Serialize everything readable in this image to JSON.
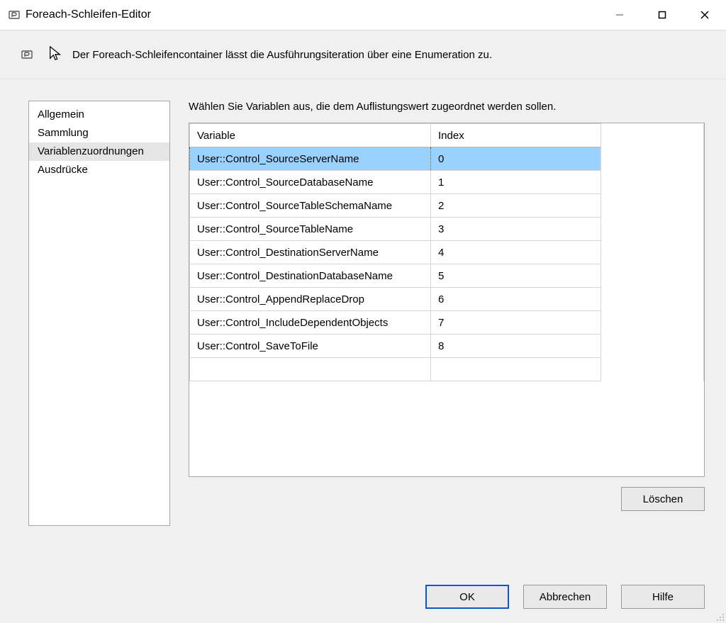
{
  "window": {
    "title": "Foreach-Schleifen-Editor"
  },
  "description": "Der Foreach-Schleifencontainer lässt die Ausführungsiteration über eine Enumeration zu.",
  "sidebar": {
    "items": [
      {
        "label": "Allgemein",
        "selected": false
      },
      {
        "label": "Sammlung",
        "selected": false
      },
      {
        "label": "Variablenzuordnungen",
        "selected": true
      },
      {
        "label": "Ausdrücke",
        "selected": false
      }
    ]
  },
  "content": {
    "instruction": "Wählen Sie Variablen aus, die dem Auflistungswert zugeordnet werden sollen.",
    "columns": {
      "variable": "Variable",
      "index": "Index"
    },
    "rows": [
      {
        "variable": "User::Control_SourceServerName",
        "index": "0",
        "selected": true
      },
      {
        "variable": "User::Control_SourceDatabaseName",
        "index": "1",
        "selected": false
      },
      {
        "variable": "User::Control_SourceTableSchemaName",
        "index": "2",
        "selected": false
      },
      {
        "variable": "User::Control_SourceTableName",
        "index": "3",
        "selected": false
      },
      {
        "variable": "User::Control_DestinationServerName",
        "index": "4",
        "selected": false
      },
      {
        "variable": "User::Control_DestinationDatabaseName",
        "index": "5",
        "selected": false
      },
      {
        "variable": "User::Control_AppendReplaceDrop",
        "index": "6",
        "selected": false
      },
      {
        "variable": "User::Control_IncludeDependentObjects",
        "index": "7",
        "selected": false
      },
      {
        "variable": "User::Control_SaveToFile",
        "index": "8",
        "selected": false
      }
    ]
  },
  "buttons": {
    "delete": "Löschen",
    "ok": "OK",
    "cancel": "Abbrechen",
    "help": "Hilfe"
  }
}
